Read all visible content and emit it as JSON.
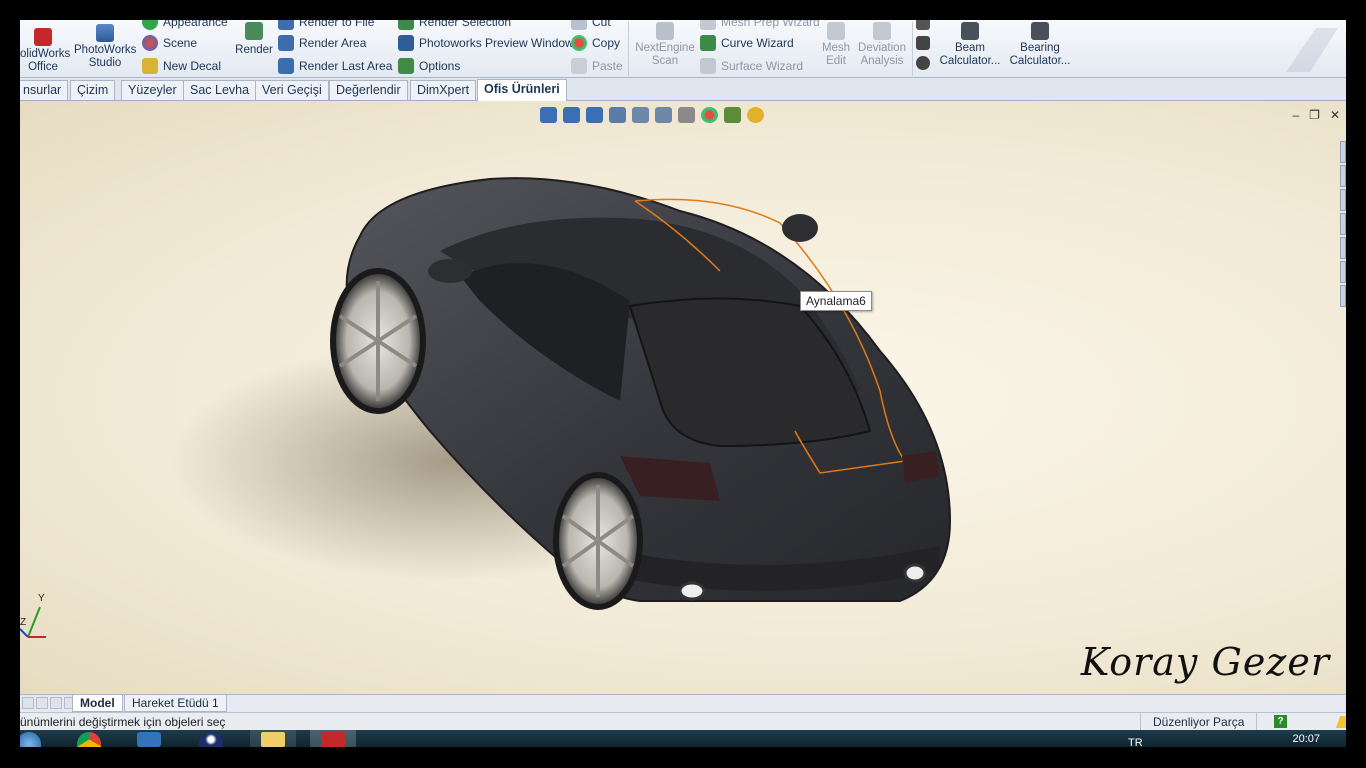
{
  "ribbon": {
    "office": {
      "line1": "olidWorks",
      "line2": "Office"
    },
    "photoworks_studio": {
      "line1": "PhotoWorks",
      "line2": "Studio"
    },
    "appearance": "Appearance",
    "scene": "Scene",
    "new_decal": "New Decal",
    "render": "Render",
    "render_to_file": "Render to File",
    "render_area": "Render Area",
    "render_last_area": "Render Last Area",
    "render_selection": "Render Selection",
    "preview_window": "Photoworks Preview Window",
    "options": "Options",
    "cut": "Cut",
    "copy": "Copy",
    "paste": "Paste",
    "nextengine": {
      "line1": "NextEngine",
      "line2": "Scan"
    },
    "mesh_prep": "Mesh Prep Wizard",
    "curve_wizard": "Curve Wizard",
    "surface_wizard": "Surface Wizard",
    "mesh_edit": {
      "line1": "Mesh",
      "line2": "Edit"
    },
    "deviation": {
      "line1": "Deviation",
      "line2": "Analysis"
    },
    "beam": {
      "line1": "Beam",
      "line2": "Calculator..."
    },
    "bearing": {
      "line1": "Bearing",
      "line2": "Calculator..."
    }
  },
  "tabs": [
    "nsurlar",
    "Çizim",
    "Yüzeyler",
    "Sac Levha",
    "Veri Geçişi",
    "Değerlendir",
    "DimXpert",
    "Ofis Ürünleri"
  ],
  "active_tab": "Ofis Ürünleri",
  "viewport": {
    "tooltip": "Aynalama6",
    "signature": "Koray Gezer",
    "triad": {
      "y": "Y",
      "z": "Z"
    }
  },
  "sheet_tabs": [
    "Model",
    "Hareket Etüdü 1"
  ],
  "status": {
    "message": "ünümlerini değiştirmek için objeleri seç",
    "mode": "Düzenliyor Parça",
    "help": "?"
  },
  "taskbar": {
    "language": "TR",
    "clock": "20:07",
    "apps": [
      "start-orb",
      "chrome",
      "media-player",
      "app-blue",
      "file-explorer",
      "solidworks"
    ]
  },
  "colors": {
    "accent": "#1c3557",
    "selection_edge": "#e07a18",
    "car_body": "#3a3b40",
    "background": "#f4ecd8"
  }
}
